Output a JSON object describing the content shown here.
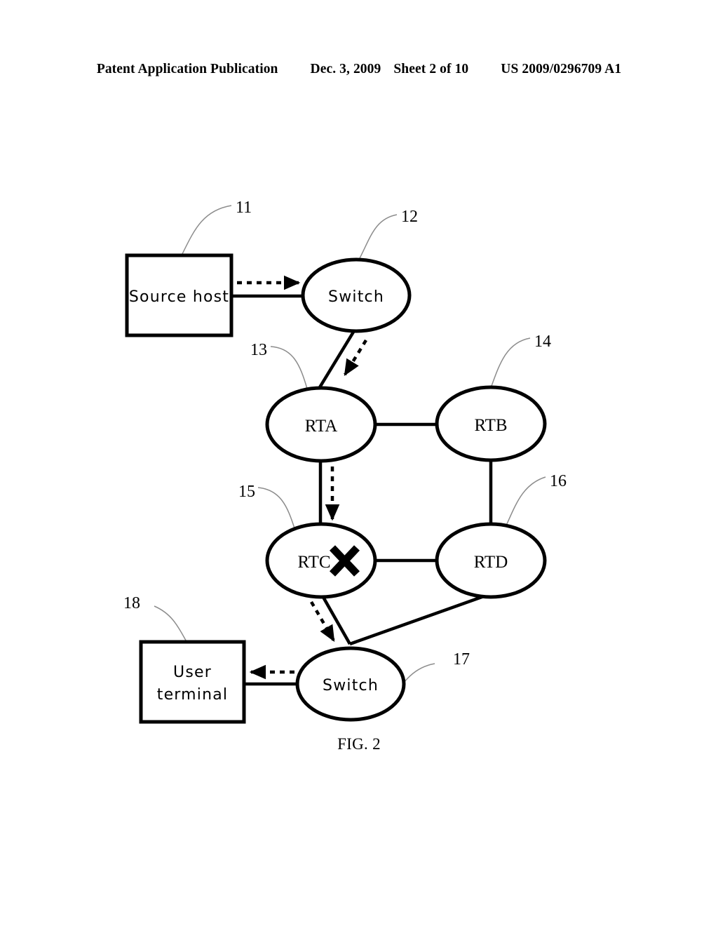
{
  "header": {
    "publication": "Patent Application Publication",
    "date": "Dec. 3, 2009",
    "sheet": "Sheet 2 of 10",
    "patent_number": "US 2009/0296709 A1"
  },
  "figure": {
    "caption": "FIG. 2",
    "nodes": [
      {
        "id": "source-host",
        "label": "Source host",
        "shape": "rect",
        "ref": "11"
      },
      {
        "id": "switch-top",
        "label": "Switch",
        "shape": "ellipse",
        "ref": "12"
      },
      {
        "id": "rta",
        "label": "RTA",
        "shape": "ellipse",
        "ref": "13"
      },
      {
        "id": "rtb",
        "label": "RTB",
        "shape": "ellipse",
        "ref": "14"
      },
      {
        "id": "rtc",
        "label": "RTC",
        "shape": "ellipse",
        "ref": "15"
      },
      {
        "id": "rtd",
        "label": "RTD",
        "shape": "ellipse",
        "ref": "16"
      },
      {
        "id": "switch-bottom",
        "label": "Switch",
        "shape": "ellipse",
        "ref": "17"
      },
      {
        "id": "user-terminal",
        "label_line1": "User",
        "label_line2": "terminal",
        "shape": "rect",
        "ref": "18"
      }
    ],
    "reference_numerals": [
      "11",
      "12",
      "13",
      "14",
      "15",
      "16",
      "17",
      "18"
    ],
    "fault_marker": {
      "name": "link-failure-cross",
      "on_node": "rtc",
      "symbol": "X"
    },
    "links": [
      {
        "from": "source-host",
        "to": "switch-top",
        "style": "solid"
      },
      {
        "from": "switch-top",
        "to": "rta",
        "style": "solid"
      },
      {
        "from": "rta",
        "to": "rtb",
        "style": "solid"
      },
      {
        "from": "rta",
        "to": "rtc",
        "style": "solid"
      },
      {
        "from": "rtb",
        "to": "rtd",
        "style": "solid"
      },
      {
        "from": "rtc",
        "to": "rtd",
        "style": "solid"
      },
      {
        "from": "rtc",
        "to": "switch-bottom",
        "style": "solid"
      },
      {
        "from": "rtd",
        "to": "switch-bottom",
        "style": "solid"
      },
      {
        "from": "switch-bottom",
        "to": "user-terminal",
        "style": "solid"
      }
    ],
    "flow_arrows": [
      {
        "from": "source-host",
        "to": "switch-top",
        "style": "dashed"
      },
      {
        "from": "switch-top",
        "to": "rta",
        "style": "dashed"
      },
      {
        "from": "rta",
        "to": "rtc",
        "style": "dashed"
      },
      {
        "from": "rtc",
        "to": "switch-bottom",
        "style": "dashed"
      },
      {
        "from": "switch-bottom",
        "to": "user-terminal",
        "style": "dashed"
      }
    ]
  },
  "colors": {
    "ink": "#000000",
    "paper": "#ffffff",
    "leader": "#8c8c8c"
  }
}
